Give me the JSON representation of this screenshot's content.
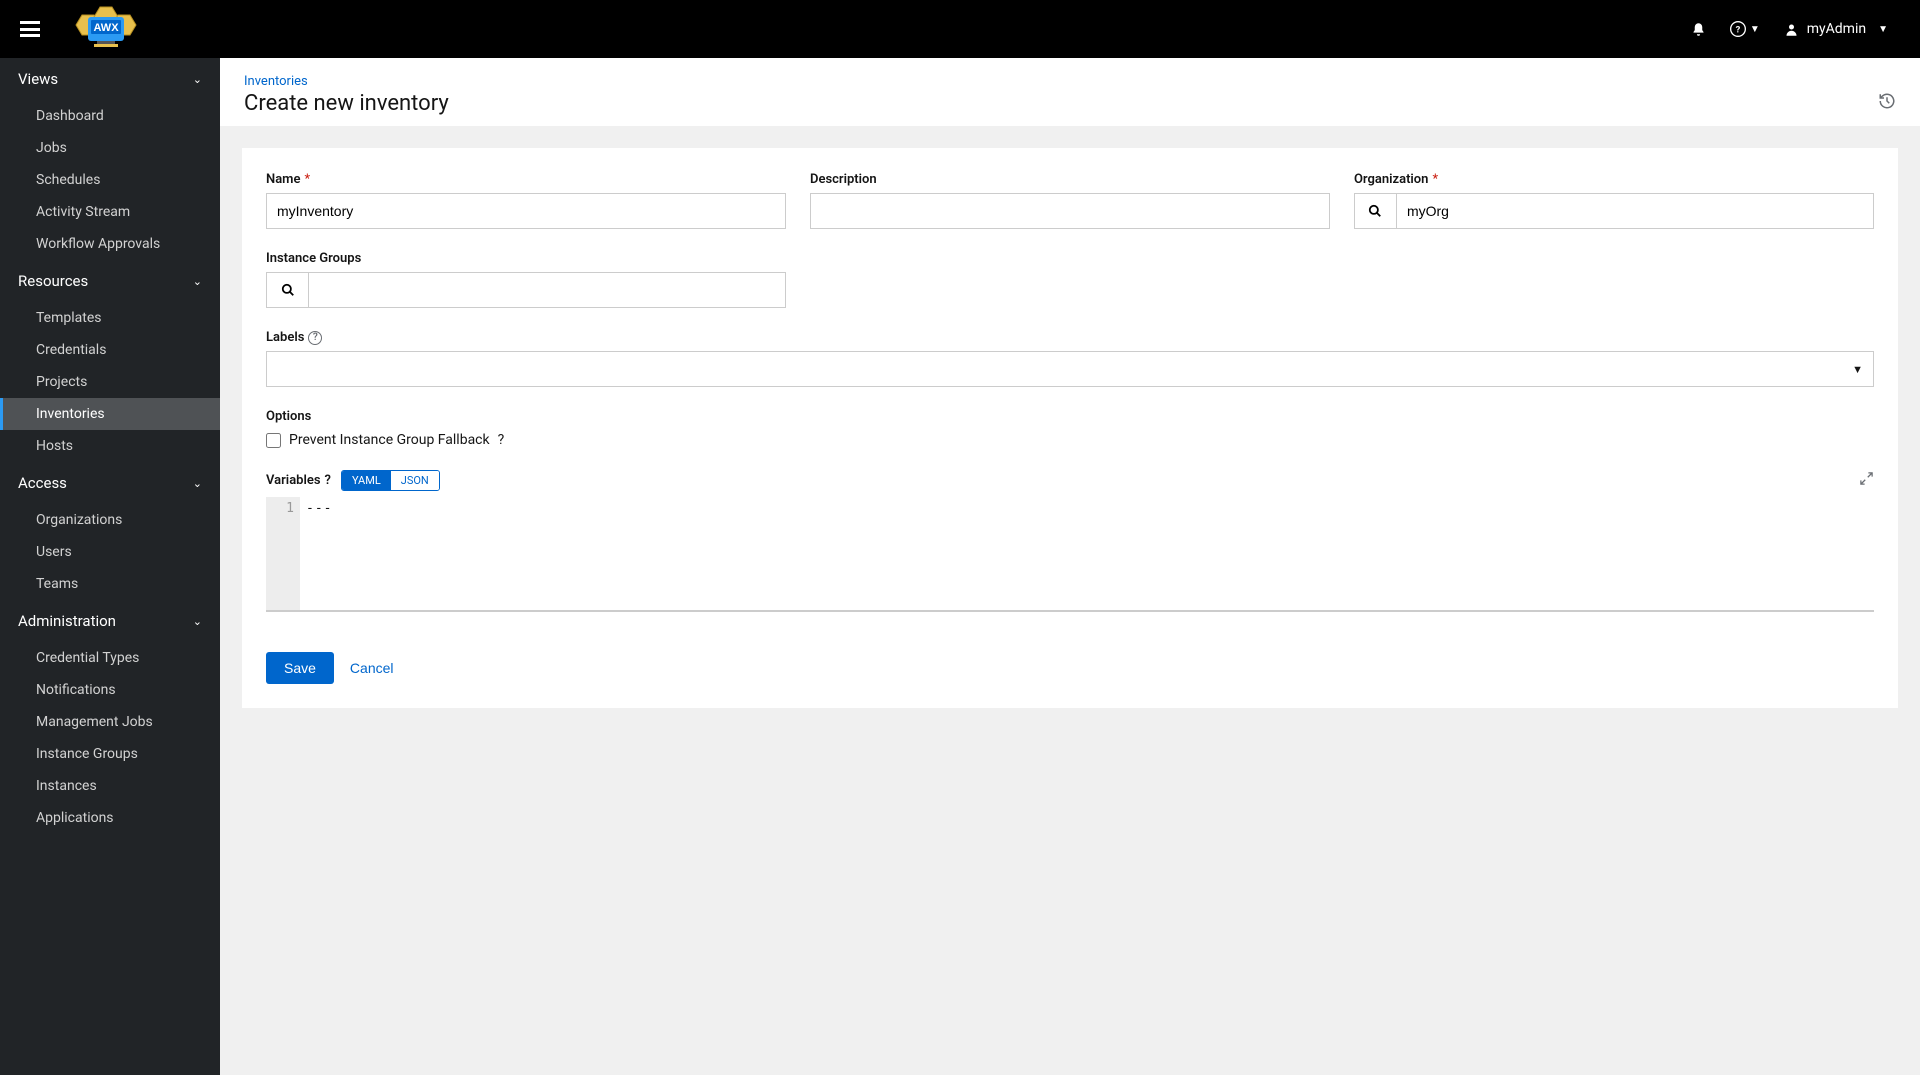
{
  "topbar": {
    "username": "myAdmin"
  },
  "sidebar": {
    "sections": [
      {
        "label": "Views",
        "items": [
          "Dashboard",
          "Jobs",
          "Schedules",
          "Activity Stream",
          "Workflow Approvals"
        ]
      },
      {
        "label": "Resources",
        "items": [
          "Templates",
          "Credentials",
          "Projects",
          "Inventories",
          "Hosts"
        ],
        "activeIndex": 3
      },
      {
        "label": "Access",
        "items": [
          "Organizations",
          "Users",
          "Teams"
        ]
      },
      {
        "label": "Administration",
        "items": [
          "Credential Types",
          "Notifications",
          "Management Jobs",
          "Instance Groups",
          "Instances",
          "Applications"
        ]
      }
    ]
  },
  "page": {
    "breadcrumb": "Inventories",
    "title": "Create new inventory"
  },
  "form": {
    "name_label": "Name",
    "name_value": "myInventory",
    "description_label": "Description",
    "description_value": "",
    "organization_label": "Organization",
    "organization_value": "myOrg",
    "instance_groups_label": "Instance Groups",
    "instance_groups_value": "",
    "labels_label": "Labels",
    "options_label": "Options",
    "prevent_fallback_label": "Prevent Instance Group Fallback",
    "variables_label": "Variables",
    "format_yaml": "YAML",
    "format_json": "JSON",
    "editor_line": "1",
    "editor_content": "---",
    "save_label": "Save",
    "cancel_label": "Cancel"
  }
}
